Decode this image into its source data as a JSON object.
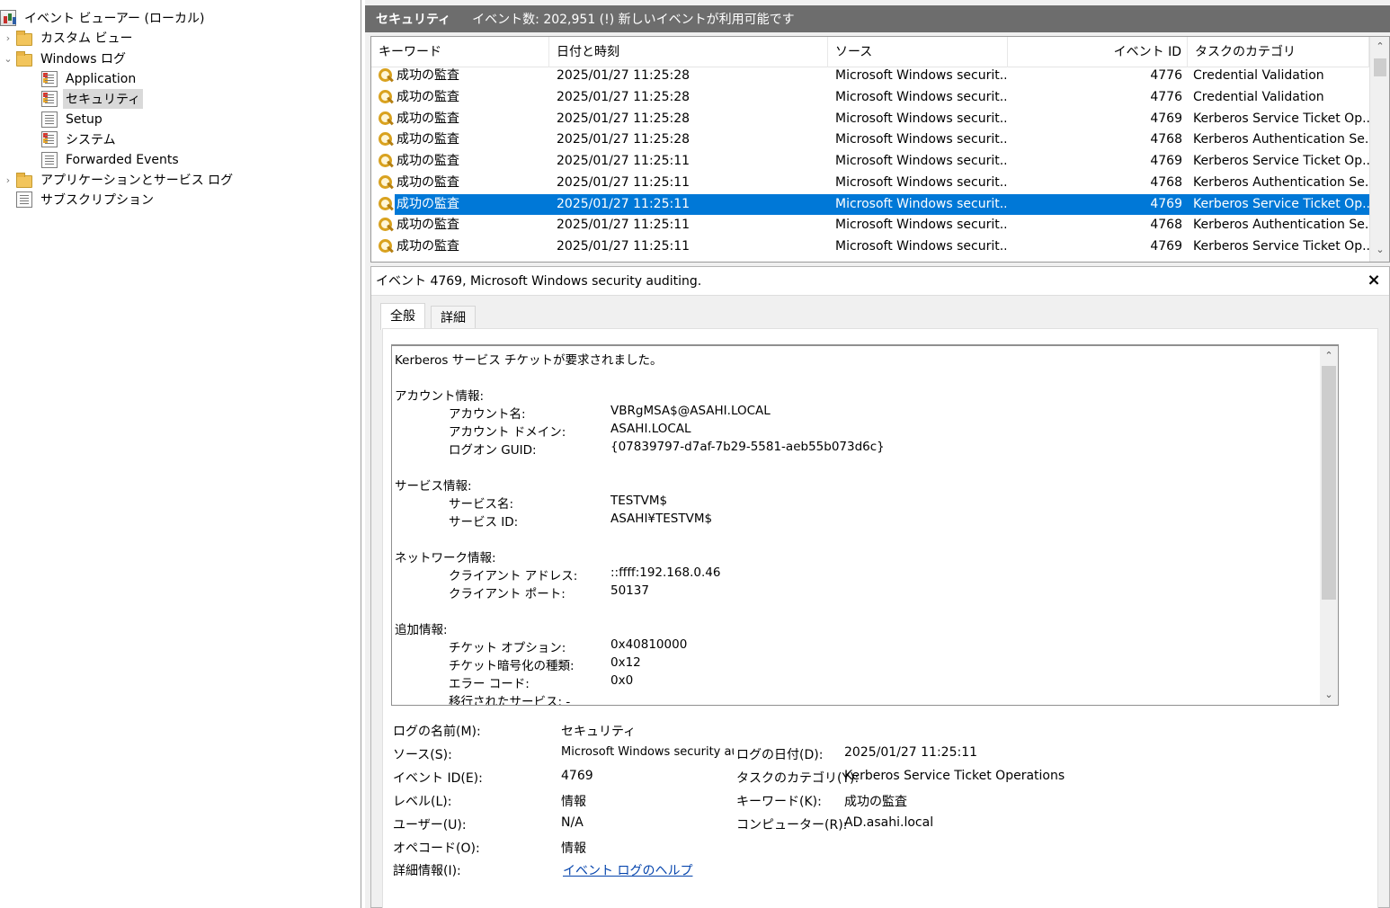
{
  "tree": {
    "root": "イベント ビューアー (ローカル)",
    "custom_views": "カスタム ビュー",
    "windows_logs": "Windows ログ",
    "application": "Application",
    "security": "セキュリティ",
    "setup": "Setup",
    "system": "システム",
    "forwarded": "Forwarded Events",
    "app_service_logs": "アプリケーションとサービス ログ",
    "subscriptions": "サブスクリプション"
  },
  "header": {
    "title": "セキュリティ",
    "info": "イベント数: 202,951 (!) 新しいイベントが利用可能です"
  },
  "columns": {
    "keyword": "キーワード",
    "datetime": "日付と時刻",
    "source": "ソース",
    "event_id": "イベント ID",
    "task_category": "タスクのカテゴリ"
  },
  "rows": [
    {
      "keyword": "成功の監査",
      "datetime": "2025/01/27 11:25:28",
      "source": "Microsoft Windows securit...",
      "event_id": "4776",
      "task": "Credential Validation"
    },
    {
      "keyword": "成功の監査",
      "datetime": "2025/01/27 11:25:28",
      "source": "Microsoft Windows securit...",
      "event_id": "4776",
      "task": "Credential Validation"
    },
    {
      "keyword": "成功の監査",
      "datetime": "2025/01/27 11:25:28",
      "source": "Microsoft Windows securit...",
      "event_id": "4769",
      "task": "Kerberos Service Ticket Op..."
    },
    {
      "keyword": "成功の監査",
      "datetime": "2025/01/27 11:25:28",
      "source": "Microsoft Windows securit...",
      "event_id": "4768",
      "task": "Kerberos Authentication Se..."
    },
    {
      "keyword": "成功の監査",
      "datetime": "2025/01/27 11:25:11",
      "source": "Microsoft Windows securit...",
      "event_id": "4769",
      "task": "Kerberos Service Ticket Op..."
    },
    {
      "keyword": "成功の監査",
      "datetime": "2025/01/27 11:25:11",
      "source": "Microsoft Windows securit...",
      "event_id": "4768",
      "task": "Kerberos Authentication Se..."
    },
    {
      "keyword": "成功の監査",
      "datetime": "2025/01/27 11:25:11",
      "source": "Microsoft Windows securit...",
      "event_id": "4769",
      "task": "Kerberos Service Ticket Op...",
      "selected": true
    },
    {
      "keyword": "成功の監査",
      "datetime": "2025/01/27 11:25:11",
      "source": "Microsoft Windows securit...",
      "event_id": "4768",
      "task": "Kerberos Authentication Se..."
    },
    {
      "keyword": "成功の監査",
      "datetime": "2025/01/27 11:25:11",
      "source": "Microsoft Windows securit...",
      "event_id": "4769",
      "task": "Kerberos Service Ticket Op..."
    }
  ],
  "detail": {
    "title": "イベント 4769, Microsoft Windows security auditing.",
    "close": "×",
    "tab_general": "全般",
    "tab_details": "詳細",
    "message": {
      "headline": "Kerberos サービス チケットが要求されました。",
      "account_section": "アカウント情報:",
      "account_name_label": "アカウント名:",
      "account_name": "VBRgMSA$@ASAHI.LOCAL",
      "account_domain_label": "アカウント ドメイン:",
      "account_domain": "ASAHI.LOCAL",
      "logon_guid_label": "ログオン GUID:",
      "logon_guid": "{07839797-d7af-7b29-5581-aeb55b073d6c}",
      "service_section": "サービス情報:",
      "service_name_label": "サービス名:",
      "service_name": "TESTVM$",
      "service_id_label": "サービス ID:",
      "service_id": "ASAHI¥TESTVM$",
      "network_section": "ネットワーク情報:",
      "client_addr_label": "クライアント アドレス:",
      "client_addr": "::ffff:192.168.0.46",
      "client_port_label": "クライアント ポート:",
      "client_port": "50137",
      "additional_section": "追加情報:",
      "ticket_options_label": "チケット オプション:",
      "ticket_options": "0x40810000",
      "ticket_enc_label": "チケット暗号化の種類:",
      "ticket_enc": "0x12",
      "error_code_label": "エラー コード:",
      "error_code": "0x0",
      "transited_label": "移行されたサービス: -"
    },
    "fields": {
      "log_name_label": "ログの名前(M):",
      "log_name": "セキュリティ",
      "source_label": "ソース(S):",
      "source": "Microsoft Windows security auc",
      "logged_label": "ログの日付(D):",
      "logged": "2025/01/27 11:25:11",
      "event_id_label": "イベント ID(E):",
      "event_id": "4769",
      "task_label": "タスクのカテゴリ(Y):",
      "task": "Kerberos Service Ticket Operations",
      "level_label": "レベル(L):",
      "level": "情報",
      "keywords_label": "キーワード(K):",
      "keywords": "成功の監査",
      "user_label": "ユーザー(U):",
      "user": "N/A",
      "computer_label": "コンピューター(R):",
      "computer": "AD.asahi.local",
      "opcode_label": "オペコード(O):",
      "opcode": "情報",
      "more_info_label": "詳細情報(I):",
      "more_info_link": "イベント ログのヘルプ"
    }
  },
  "colors": {
    "selection": "#0078d7",
    "header_bar": "#6d6d6d",
    "link": "#0645ad"
  }
}
